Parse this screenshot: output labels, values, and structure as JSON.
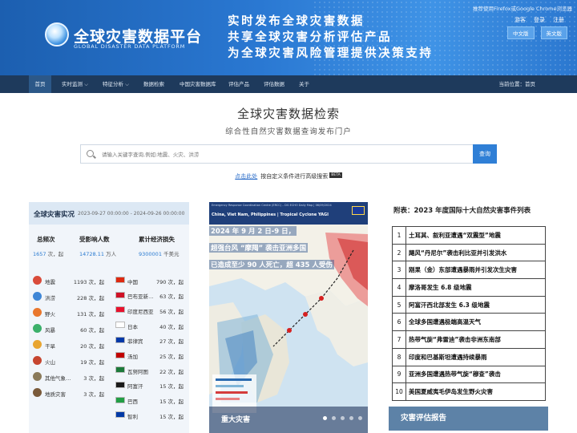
{
  "header": {
    "logo_title": "全球灾害数据平台",
    "logo_subtitle": "GLOBAL DISASTER DATA PLATFORM",
    "slogans": [
      "实时发布全球灾害数据",
      "共享全球灾害分析评估产品",
      "为全球灾害风险管理提供决策支持"
    ],
    "browser_tip": "推荐使用Firefox或Google Chrome浏览器",
    "links": [
      "游客",
      "登录",
      "注册"
    ],
    "languages": [
      "中文版",
      "英文版"
    ]
  },
  "nav": {
    "items": [
      "首页",
      "实时监测",
      "特征分析",
      "数据检索",
      "中国灾害数据库",
      "评估产品",
      "评估数据",
      "关于"
    ],
    "dropdown_arrows": [
      "⌵",
      "⌵"
    ],
    "location": "当前位置：首页"
  },
  "search": {
    "title": "全球灾害数据检索",
    "subtitle": "综合性自然灾害数据查询发布门户",
    "placeholder": "请输入关键字查询,例如:地震、火灾、洪涝",
    "button": "查询",
    "advanced_link": "点击此处",
    "advanced_text": "按自定义条件进行高级搜索",
    "beta": "BETA"
  },
  "realtime": {
    "title": "全球灾害实况",
    "date_range": "2023-09-27 00:00:00 - 2024-09-26 00:00:00",
    "stats": [
      {
        "label": "总频次",
        "value": "1657",
        "unit": "次，起"
      },
      {
        "label": "受影响人数",
        "value": "14728.11",
        "unit": "万人"
      },
      {
        "label": "累计经济损失",
        "value": "9300001",
        "unit": "千美元"
      }
    ],
    "hazards": [
      {
        "name": "地震",
        "count": "1193 次，起",
        "color": "#d94b3a"
      },
      {
        "name": "洪涝",
        "count": "228 次，起",
        "color": "#3f86d6"
      },
      {
        "name": "野火",
        "count": "131 次，起",
        "color": "#e9772d"
      },
      {
        "name": "风暴",
        "count": "60 次，起",
        "color": "#3bb06a"
      },
      {
        "name": "干旱",
        "count": "20 次，起",
        "color": "#e8a531"
      },
      {
        "name": "火山",
        "count": "19 次，起",
        "color": "#c6452f"
      },
      {
        "name": "其他气象…",
        "count": "3 次，起",
        "color": "#8a7a5a"
      },
      {
        "name": "地质灾害",
        "count": "3 次，起",
        "color": "#7a5a3a"
      }
    ],
    "countries": [
      {
        "name": "中国",
        "count": "790 次，起",
        "flag": "#de2910"
      },
      {
        "name": "巴布亚新…",
        "count": "63 次，起",
        "flag": "#cf1126"
      },
      {
        "name": "印度尼西亚",
        "count": "56 次，起",
        "flag": "#e8112d"
      },
      {
        "name": "日本",
        "count": "40 次，起",
        "flag": "#ffffff"
      },
      {
        "name": "菲律宾",
        "count": "27 次，起",
        "flag": "#0038a8"
      },
      {
        "name": "汤加",
        "count": "25 次，起",
        "flag": "#c10000"
      },
      {
        "name": "瓦努阿图",
        "count": "22 次，起",
        "flag": "#1c7a3a"
      },
      {
        "name": "阿富汗",
        "count": "15 次，起",
        "flag": "#1a1a1a"
      },
      {
        "name": "巴西",
        "count": "15 次，起",
        "flag": "#229e45"
      },
      {
        "name": "智利",
        "count": "15 次，起",
        "flag": "#0039a6"
      }
    ]
  },
  "featured": {
    "map_source": "Emergency Response Coordination Centre (ERCC) – DG ECHO Daily Map | 06/09/2024",
    "map_title": "China, Viet Nam, Philippines | Tropical Cyclone YAGI",
    "overlay_lines": [
      "2024 年 9 月 2 日-9 日，",
      "超强台风 “摩羯” 袭击亚洲多国",
      "已造成至少 90 人死亡，超 435 人受伤"
    ],
    "caption": "重大灾害",
    "slides_count": 5
  },
  "top10": {
    "title": "附表：2023 年度国际十大自然灾害事件列表",
    "rows": [
      {
        "n": "1",
        "event": "土耳其、叙利亚遭遇“双震型”地震"
      },
      {
        "n": "2",
        "event": "飓风“丹尼尔”袭击利比亚并引发洪水"
      },
      {
        "n": "3",
        "event": "刚果（金）东部遭遇暴雨并引发次生灾害"
      },
      {
        "n": "4",
        "event": "摩洛哥发生 6.8 级地震"
      },
      {
        "n": "5",
        "event": "阿富汗西北部发生 6.3 级地震"
      },
      {
        "n": "6",
        "event": "全球多国遭遇极端高温天气"
      },
      {
        "n": "7",
        "event": "热带气旋“弗雷迪”袭击非洲东南部"
      },
      {
        "n": "8",
        "event": "印度和巴基斯坦遭遇持续暴雨"
      },
      {
        "n": "9",
        "event": "亚洲多国遭遇热带气旋“穆查”袭击"
      },
      {
        "n": "10",
        "event": "美国夏威夷毛伊岛发生野火灾害"
      }
    ],
    "eval_button": "灾害评估报告"
  }
}
